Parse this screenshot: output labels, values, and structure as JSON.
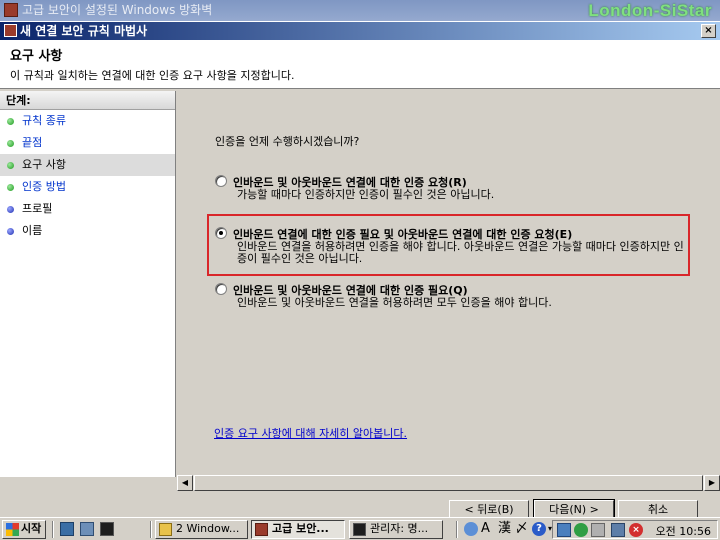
{
  "outer_window": {
    "title": "고급 보안이 설정된 Windows 방화벽",
    "watermark": "London-SiStar"
  },
  "dialog": {
    "title": "새 연결 보안 규칙 마법사",
    "close_label": "×"
  },
  "header": {
    "title": "요구 사항",
    "description": "이 규칙과 일치하는 연결에 대한 인증 요구 사항을 지정합니다."
  },
  "steps": {
    "heading": "단계:",
    "items": [
      {
        "label": "규칙 종류",
        "state": "done"
      },
      {
        "label": "끝점",
        "state": "done"
      },
      {
        "label": "요구 사항",
        "state": "current"
      },
      {
        "label": "인증 방법",
        "state": "done"
      },
      {
        "label": "프로필",
        "state": "todo"
      },
      {
        "label": "이름",
        "state": "todo"
      }
    ]
  },
  "main": {
    "question": "인증을 언제 수행하시겠습니까?",
    "options": [
      {
        "label": "인바운드 및 아웃바운드 연결에 대한 인증 요청(R)",
        "description": "가능할 때마다 인증하지만 인증이 필수인 것은 아닙니다.",
        "checked": false
      },
      {
        "label": "인바운드 연결에 대한 인증 필요 및 아웃바운드 연결에 대한 인증 요청(E)",
        "description": "인바운드 연결을 허용하려면 인증을 해야 합니다. 아웃바운드 연결은 가능할 때마다 인증하지만 인증이 필수인 것은 아닙니다.",
        "checked": true
      },
      {
        "label": "인바운드 및 아웃바운드 연결에 대한 인증 필요(Q)",
        "description": "인바운드 및 아웃바운드 연결을 허용하려면 모두 인증을 해야 합니다.",
        "checked": false
      }
    ],
    "more_link": "인증 요구 사항에 대해 자세히 알아봅니다."
  },
  "buttons": {
    "back": "< 뒤로(B)",
    "next": "다음(N) >",
    "cancel": "취소"
  },
  "taskbar": {
    "start_label": "시작",
    "items": [
      {
        "label": "2 Window..."
      },
      {
        "label": "고급 보안..."
      },
      {
        "label": "관리자: 명..."
      }
    ],
    "clock": "오전 10:56"
  },
  "colors": {
    "title_bar": "#0a246a",
    "highlight_box": "#d9262a",
    "link": "#0000cc"
  }
}
